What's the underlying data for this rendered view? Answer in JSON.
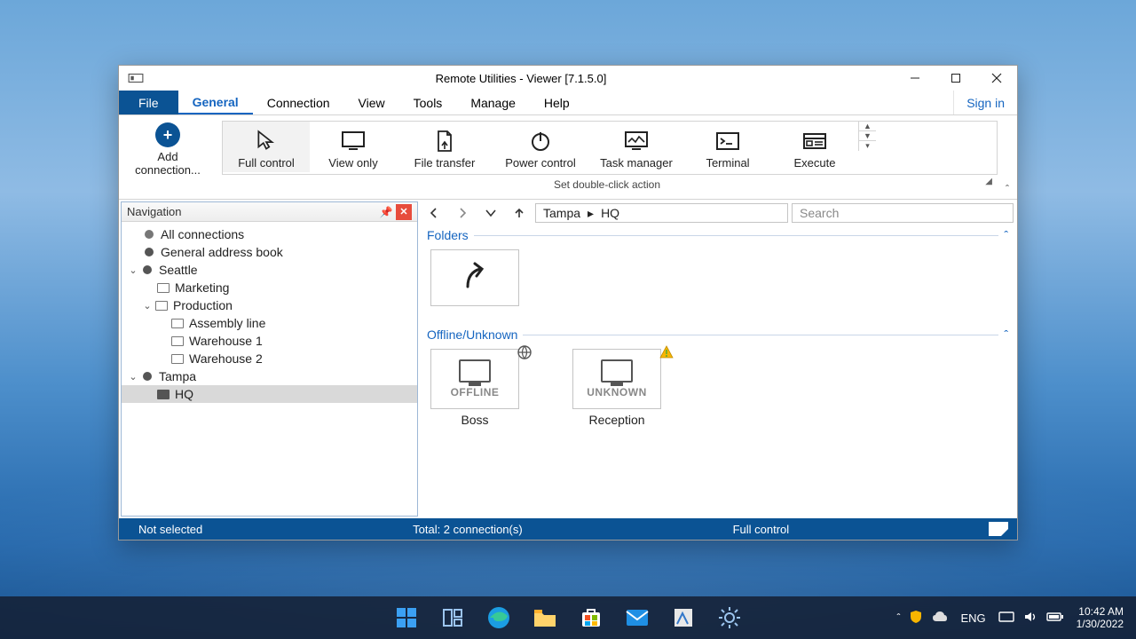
{
  "window": {
    "title": "Remote Utilities - Viewer [7.1.5.0]",
    "signin": "Sign in"
  },
  "menus": {
    "file": "File",
    "general": "General",
    "connection": "Connection",
    "view": "View",
    "tools": "Tools",
    "manage": "Manage",
    "help": "Help"
  },
  "ribbon": {
    "add": "Add connection...",
    "full_control": "Full control",
    "view_only": "View only",
    "file_transfer": "File transfer",
    "power_control": "Power control",
    "task_manager": "Task manager",
    "terminal": "Terminal",
    "execute": "Execute",
    "caption": "Set double-click action"
  },
  "navigation": {
    "title": "Navigation",
    "items": {
      "all": "All connections",
      "general_ab": "General address book",
      "seattle": "Seattle",
      "marketing": "Marketing",
      "production": "Production",
      "assembly": "Assembly line",
      "wh1": "Warehouse 1",
      "wh2": "Warehouse 2",
      "tampa": "Tampa",
      "hq": "HQ"
    }
  },
  "breadcrumb": {
    "seg1": "Tampa",
    "seg2": "HQ",
    "search_placeholder": "Search"
  },
  "sections": {
    "folders": "Folders",
    "offline": "Offline/Unknown"
  },
  "connections": {
    "boss": {
      "status": "OFFLINE",
      "name": "Boss"
    },
    "reception": {
      "status": "UNKNOWN",
      "name": "Reception"
    }
  },
  "status": {
    "selection": "Not selected",
    "total": "Total: 2 connection(s)",
    "mode": "Full control"
  },
  "taskbar": {
    "lang": "ENG",
    "time": "10:42 AM",
    "date": "1/30/2022"
  }
}
